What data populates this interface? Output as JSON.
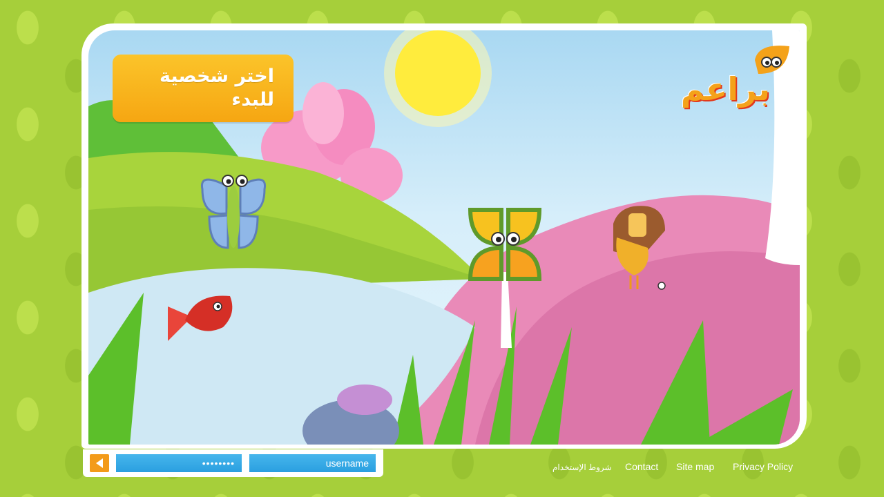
{
  "scene": {
    "start_prompt": "اختر شخصية\nللبدء",
    "logo_text": "براعم"
  },
  "login": {
    "password_value": "••••••••",
    "username_value": "username"
  },
  "footer": {
    "terms": "شروط الإستخدام",
    "contact": "Contact",
    "site_map": "Site map",
    "privacy_policy": "Privacy Policy"
  },
  "colors": {
    "background_green": "#a6cf3a",
    "banner_orange": "#f6a612",
    "field_blue": "#2a9fe0"
  },
  "icons": {
    "back": "arrow-left-icon"
  }
}
